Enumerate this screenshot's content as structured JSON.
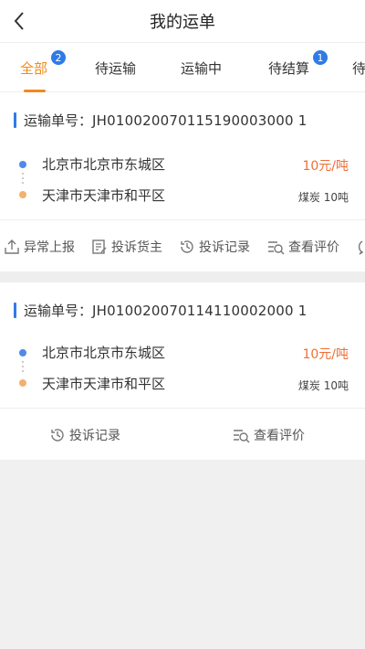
{
  "header": {
    "title": "我的运单"
  },
  "tabs": [
    {
      "label": "全部",
      "badge": "2",
      "active": true
    },
    {
      "label": "待运输"
    },
    {
      "label": "运输中"
    },
    {
      "label": "待结算",
      "badge": "1"
    },
    {
      "label": "待"
    }
  ],
  "orders": [
    {
      "order_label": "运输单号：",
      "order_no": "JH010020070115190003000 1",
      "from": "北京市北京市东城区",
      "to": "天津市天津市和平区",
      "price": "10元/吨",
      "cargo": "煤炭 10吨",
      "actions": [
        "异常上报",
        "投诉货主",
        "投诉记录",
        "查看评价"
      ]
    },
    {
      "order_label": "运输单号：",
      "order_no": "JH010020070114110002000 1",
      "from": "北京市北京市东城区",
      "to": "天津市天津市和平区",
      "price": "10元/吨",
      "cargo": "煤炭 10吨",
      "actions": [
        "投诉记录",
        "查看评价"
      ]
    }
  ],
  "colors": {
    "accent": "#f08a1c",
    "blue": "#2f7be6",
    "price": "#ec6f36"
  }
}
